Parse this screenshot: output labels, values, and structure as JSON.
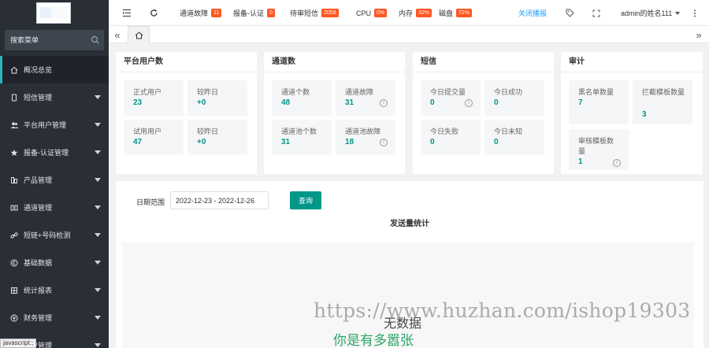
{
  "sidebar": {
    "search_placeholder": "搜索菜单",
    "items": [
      {
        "label": "概况总览",
        "icon": "home-icon",
        "active": true
      },
      {
        "label": "短信管理",
        "icon": "phone-icon"
      },
      {
        "label": "平台用户管理",
        "icon": "users-icon"
      },
      {
        "label": "报备-认证管理",
        "icon": "star-icon"
      },
      {
        "label": "产品管理",
        "icon": "product-icon"
      },
      {
        "label": "通道管理",
        "icon": "channel-icon"
      },
      {
        "label": "短链+号码检测",
        "icon": "link-icon"
      },
      {
        "label": "基础数据",
        "icon": "copyright-icon"
      },
      {
        "label": "统计报表",
        "icon": "grid-icon"
      },
      {
        "label": "财务管理",
        "icon": "finance-icon"
      },
      {
        "label": "用户管理",
        "icon": "user-icon"
      }
    ]
  },
  "status_tip": "javascript:;",
  "topbar": {
    "channel_fault_label": "通道故障",
    "channel_fault_count": "11",
    "report_auth_label": "报备-认证",
    "report_auth_count": "0",
    "pending_sms_label": "待审短信",
    "pending_sms_count": "2058",
    "cpu_label": "CPU",
    "cpu_value": "0%",
    "mem_label": "内存",
    "mem_value": "32%",
    "disk_label": "磁盘",
    "disk_value": "72%",
    "broadcast_link": "关闭播报",
    "username": "admin的姓名111"
  },
  "cards": {
    "users": {
      "title": "平台用户数",
      "stats": [
        {
          "label": "正式用户",
          "value": "23"
        },
        {
          "label": "较昨日",
          "value": "+0"
        },
        {
          "label": "试用用户",
          "value": "47"
        },
        {
          "label": "较昨日",
          "value": "+0"
        }
      ]
    },
    "channels": {
      "title": "通道数",
      "stats": [
        {
          "label": "通道个数",
          "value": "48"
        },
        {
          "label": "通道故障",
          "value": "31"
        },
        {
          "label": "通道池个数",
          "value": "31"
        },
        {
          "label": "通道池故障",
          "value": "18"
        }
      ]
    },
    "sms": {
      "title": "短信",
      "stats": [
        {
          "label": "今日提交量",
          "value": "0"
        },
        {
          "label": "今日成功",
          "value": "0"
        },
        {
          "label": "今日失败",
          "value": "0"
        },
        {
          "label": "今日未知",
          "value": "0"
        }
      ]
    },
    "audit": {
      "title": "审计",
      "stats": [
        {
          "label": "黑名单数量",
          "value": "7"
        },
        {
          "label": "拦截模板数量",
          "value": "3"
        },
        {
          "label": "审核模板数量",
          "value": "1"
        }
      ]
    }
  },
  "main": {
    "date_label": "日期范围",
    "date_value": "2022-12-23 - 2022-12-26",
    "query_button": "查询",
    "chart_title": "发送量统计",
    "no_data": "无数据"
  },
  "watermark": {
    "url": "https://www.huzhan.com/ishop19303",
    "subtitle": "你是有多嚣张"
  },
  "colors": {
    "accent": "#009688",
    "badge": "#ff5722",
    "sidebar": "#2a2f36",
    "link": "#1e9fff"
  }
}
